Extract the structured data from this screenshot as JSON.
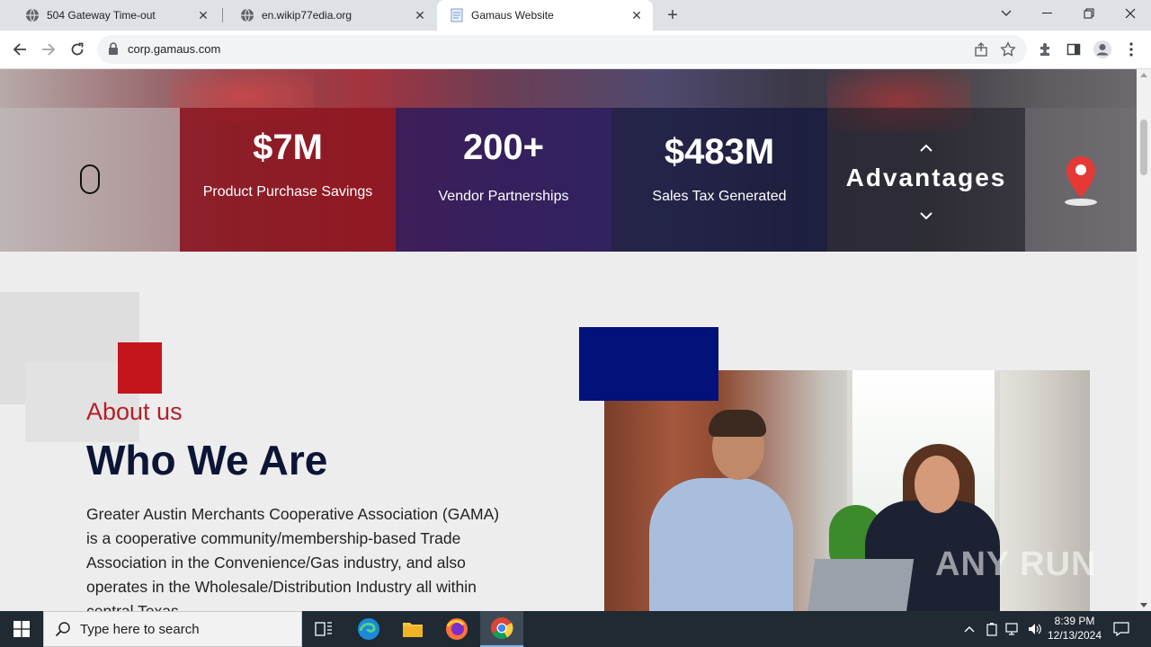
{
  "browser": {
    "tabs": [
      {
        "title": "504 Gateway Time-out",
        "favicon": "globe-icon"
      },
      {
        "title": "en.wikip77edia.org",
        "favicon": "globe-icon"
      },
      {
        "title": "Gamaus Website",
        "favicon": "page-icon"
      }
    ],
    "active_tab": 2,
    "url": "corp.gamaus.com"
  },
  "stats": [
    {
      "value": "$7M",
      "label": "Product Purchase Savings"
    },
    {
      "value": "200+",
      "label": "Vendor Partnerships"
    },
    {
      "value": "$483M",
      "label": "Sales Tax Generated"
    }
  ],
  "advantages_label": "Advantages",
  "about": {
    "kicker": "About us",
    "title": "Who We Are",
    "text": "Greater Austin Merchants Cooperative Association (GAMA) is a cooperative community/membership-based Trade Association in the Convenience/Gas industry, and also operates in the Wholesale/Distribution Industry all within central Texas."
  },
  "watermark": "ANY RUN",
  "taskbar": {
    "search_placeholder": "Type here to search",
    "time": "8:39 PM",
    "date": "12/13/2024"
  },
  "colors": {
    "accent_red": "#b3202a",
    "navy": "#0d1537",
    "deco_navy": "#03127a"
  }
}
